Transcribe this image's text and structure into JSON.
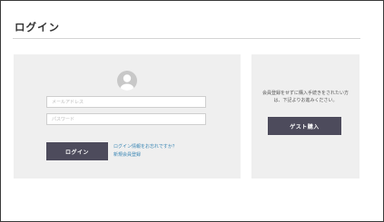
{
  "page": {
    "title": "ログイン"
  },
  "login": {
    "email_placeholder": "メールアドレス",
    "password_placeholder": "パスワード",
    "login_button": "ログイン",
    "forgot_link": "ログイン情報をお忘れですか？",
    "register_link": "新規会員登録"
  },
  "guest": {
    "message": "会員登録をせずに購入手続きをされたい方は、下記よりお進みください。",
    "purchase_button": "ゲスト購入"
  },
  "colors": {
    "button_bg": "#4d4b5c",
    "link": "#3a86b4",
    "panel_bg": "#efefef"
  },
  "icons": {
    "avatar": "user-avatar-icon"
  }
}
